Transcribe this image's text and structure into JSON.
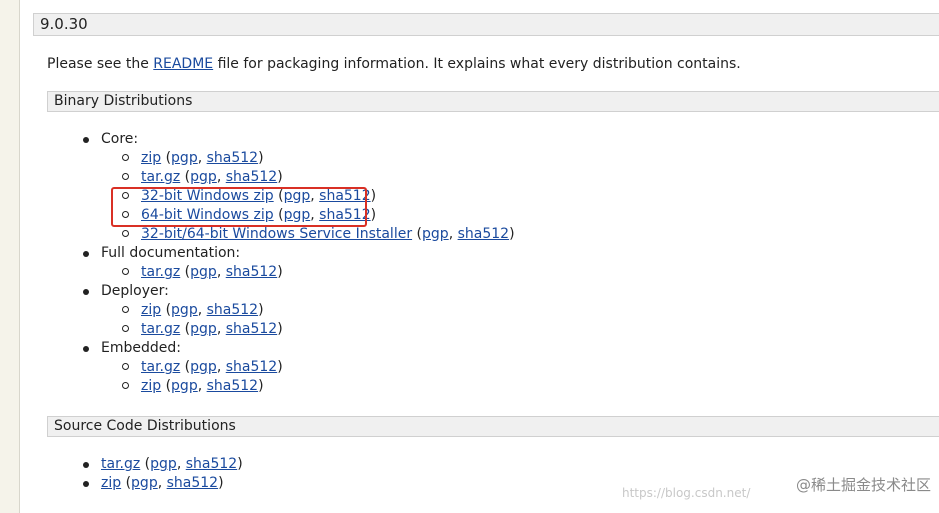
{
  "version": "9.0.30",
  "intro": {
    "before": "Please see the ",
    "link": "README",
    "after": " file for packaging information. It explains what every distribution contains."
  },
  "binary": {
    "header": "Binary Distributions",
    "groups": [
      {
        "label": "Core:",
        "items": [
          {
            "main": "zip",
            "pgp": "pgp",
            "sha": "sha512"
          },
          {
            "main": "tar.gz",
            "pgp": "pgp",
            "sha": "sha512"
          },
          {
            "main": "32-bit Windows zip",
            "pgp": "pgp",
            "sha": "sha512"
          },
          {
            "main": "64-bit Windows zip",
            "pgp": "pgp",
            "sha": "sha512"
          },
          {
            "main": "32-bit/64-bit Windows Service Installer",
            "pgp": "pgp",
            "sha": "sha512"
          }
        ]
      },
      {
        "label": "Full documentation:",
        "items": [
          {
            "main": "tar.gz",
            "pgp": "pgp",
            "sha": "sha512"
          }
        ]
      },
      {
        "label": "Deployer:",
        "items": [
          {
            "main": "zip",
            "pgp": "pgp",
            "sha": "sha512"
          },
          {
            "main": "tar.gz",
            "pgp": "pgp",
            "sha": "sha512"
          }
        ]
      },
      {
        "label": "Embedded:",
        "items": [
          {
            "main": "tar.gz",
            "pgp": "pgp",
            "sha": "sha512"
          },
          {
            "main": "zip",
            "pgp": "pgp",
            "sha": "sha512"
          }
        ]
      }
    ]
  },
  "source": {
    "header": "Source Code Distributions",
    "items": [
      {
        "main": "tar.gz",
        "pgp": "pgp",
        "sha": "sha512"
      },
      {
        "main": "zip",
        "pgp": "pgp",
        "sha": "sha512"
      }
    ]
  },
  "punct": {
    "open": " (",
    "comma": ", ",
    "close": ")"
  },
  "watermark": {
    "text": "@稀土掘金技术社区",
    "url": "https://blog.csdn.net/"
  },
  "colors": {
    "link": "#1a4a9e",
    "highlight": "#d93025",
    "header_bg": "#f0f0f0"
  }
}
